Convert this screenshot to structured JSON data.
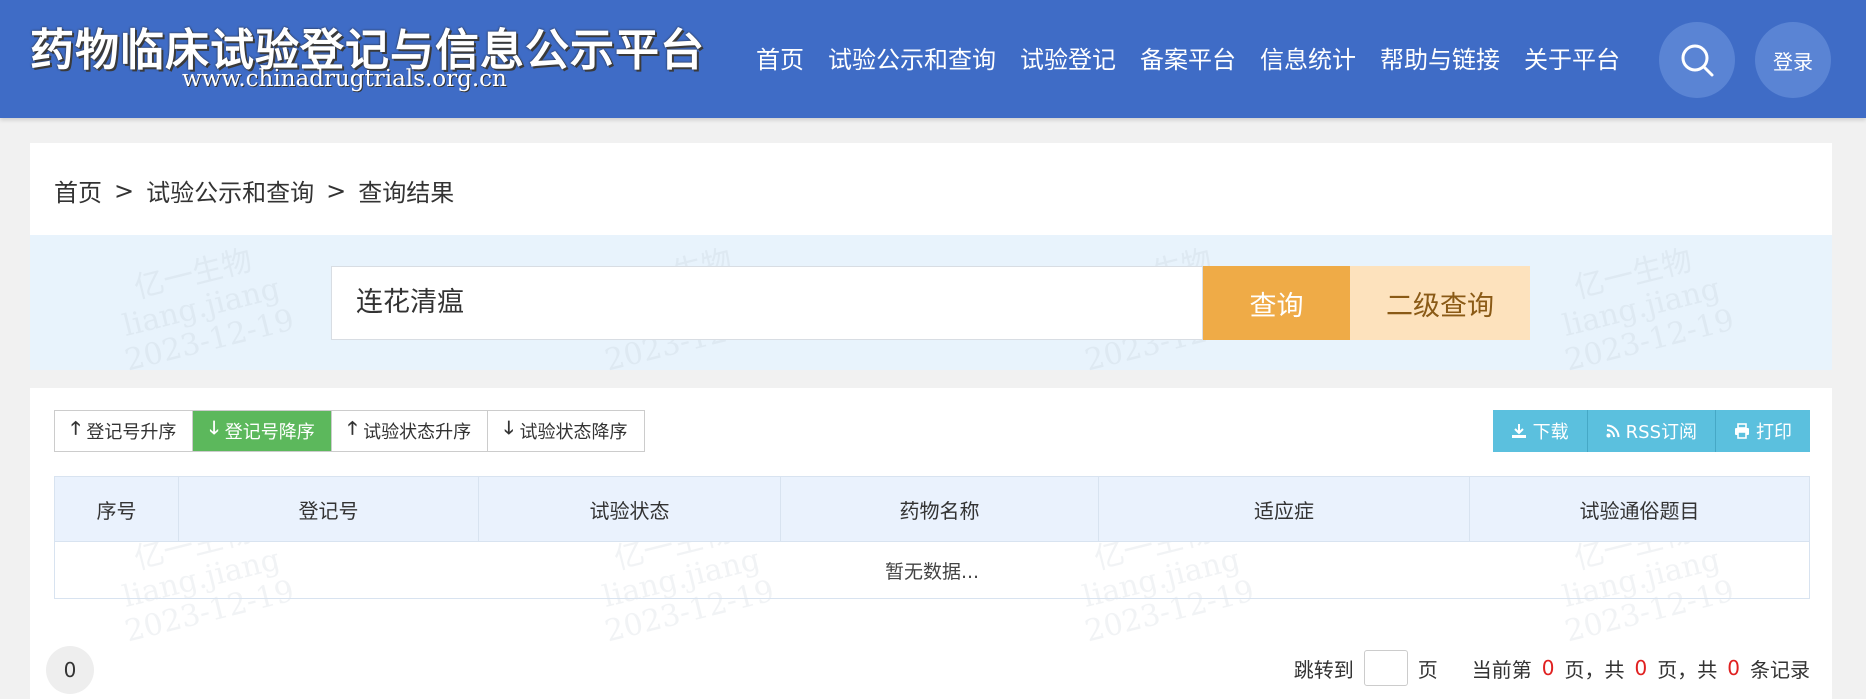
{
  "header": {
    "title": "药物临床试验登记与信息公示平台",
    "url": "www.chinadrugtrials.org.cn",
    "nav": [
      "首页",
      "试验公示和查询",
      "试验登记",
      "备案平台",
      "信息统计",
      "帮助与链接",
      "关于平台"
    ],
    "search_icon": "search-icon",
    "login_label": "登录"
  },
  "breadcrumb": {
    "items": [
      "首页",
      "试验公示和查询",
      "查询结果"
    ],
    "separator": ">"
  },
  "search": {
    "value": "连花清瘟",
    "search_label": "查询",
    "advanced_label": "二级查询"
  },
  "toolbar": {
    "sort_buttons": [
      {
        "label": "登记号升序",
        "icon": "arrow-up-icon",
        "active": false
      },
      {
        "label": "登记号降序",
        "icon": "arrow-down-icon",
        "active": true
      },
      {
        "label": "试验状态升序",
        "icon": "arrow-up-icon",
        "active": false
      },
      {
        "label": "试验状态降序",
        "icon": "arrow-down-icon",
        "active": false
      }
    ],
    "actions": [
      {
        "label": "下载",
        "icon": "download-icon"
      },
      {
        "label": "RSS订阅",
        "icon": "rss-icon"
      },
      {
        "label": "打印",
        "icon": "print-icon"
      }
    ]
  },
  "table": {
    "columns": [
      "序号",
      "登记号",
      "试验状态",
      "药物名称",
      "适应症",
      "试验通俗题目"
    ],
    "empty_text": "暂无数据..."
  },
  "pagination": {
    "count_badge": "0",
    "jump_label": "跳转到",
    "page_unit": "页",
    "current_prefix": "当前第",
    "current_page": "0",
    "current_suffix": "页，共",
    "total_pages": "0",
    "total_pages_suffix": "页，共",
    "total_records": "0",
    "records_suffix": "条记录"
  },
  "watermark": {
    "lines": [
      "亿一生物",
      "liang.jiang",
      "2023-12-19"
    ]
  },
  "colors": {
    "header_bg": "#3f6cc6",
    "search_button": "#efab47",
    "advanced_button": "#fde2bd",
    "active_sort": "#5cb85c",
    "action_button": "#5bc0de",
    "highlight_red": "#e02020"
  }
}
